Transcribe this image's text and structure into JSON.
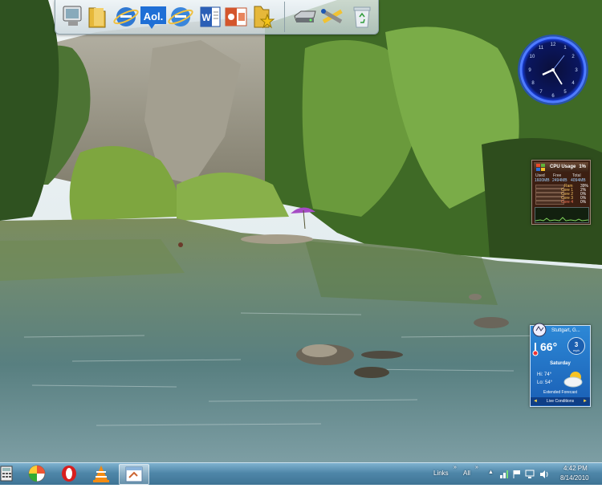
{
  "dock": {
    "items": [
      {
        "name": "computer-icon"
      },
      {
        "name": "folder-icon"
      },
      {
        "name": "internet-explorer-icon"
      },
      {
        "name": "aol-icon",
        "label": "Aol."
      },
      {
        "name": "internet-explorer-icon-2"
      },
      {
        "name": "word-icon",
        "label": "W"
      },
      {
        "name": "powerpoint-icon"
      },
      {
        "name": "favorites-folder-icon"
      },
      {
        "name": "drive-icon"
      },
      {
        "name": "tools-icon"
      },
      {
        "name": "recycle-bin-icon"
      }
    ]
  },
  "cpu_gadget": {
    "title": "CPU Usage",
    "percent": "1%",
    "used_label": "Used",
    "free_label": "Free",
    "total_label": "Total",
    "used": "1600MB",
    "free": "2494MB",
    "total": "4094MB",
    "rows": [
      {
        "label": "Ram",
        "value": "39%"
      },
      {
        "label": "Core 1",
        "value": "2%"
      },
      {
        "label": "Core 2",
        "value": "0%"
      },
      {
        "label": "Core 3",
        "value": "0%"
      },
      {
        "label": "Core 4",
        "value": "0%"
      }
    ]
  },
  "weather_gadget": {
    "city": "Stuttgart, G...",
    "temperature": "66°",
    "wind": "3",
    "wind_unit": "mph",
    "day": "Saturday",
    "high": "Hi: 74°",
    "low": "Lo: 54°",
    "extended": "Extended Forecast",
    "live": "Live Conditions"
  },
  "taskbar": {
    "apps": [
      {
        "name": "calculator-icon"
      },
      {
        "name": "beach-ball-icon"
      },
      {
        "name": "opera-icon"
      },
      {
        "name": "vlc-icon"
      },
      {
        "name": "paint-icon",
        "active": true
      }
    ],
    "links_label": "Links",
    "all_label": "All",
    "time": "4:42 PM",
    "date": "8/14/2010"
  },
  "colors": {
    "taskbar": "#4f87a9",
    "cpu_bg": "#3c1f12",
    "weather_bg": "#2d88d6",
    "clock_ring": "#1e4cff"
  }
}
